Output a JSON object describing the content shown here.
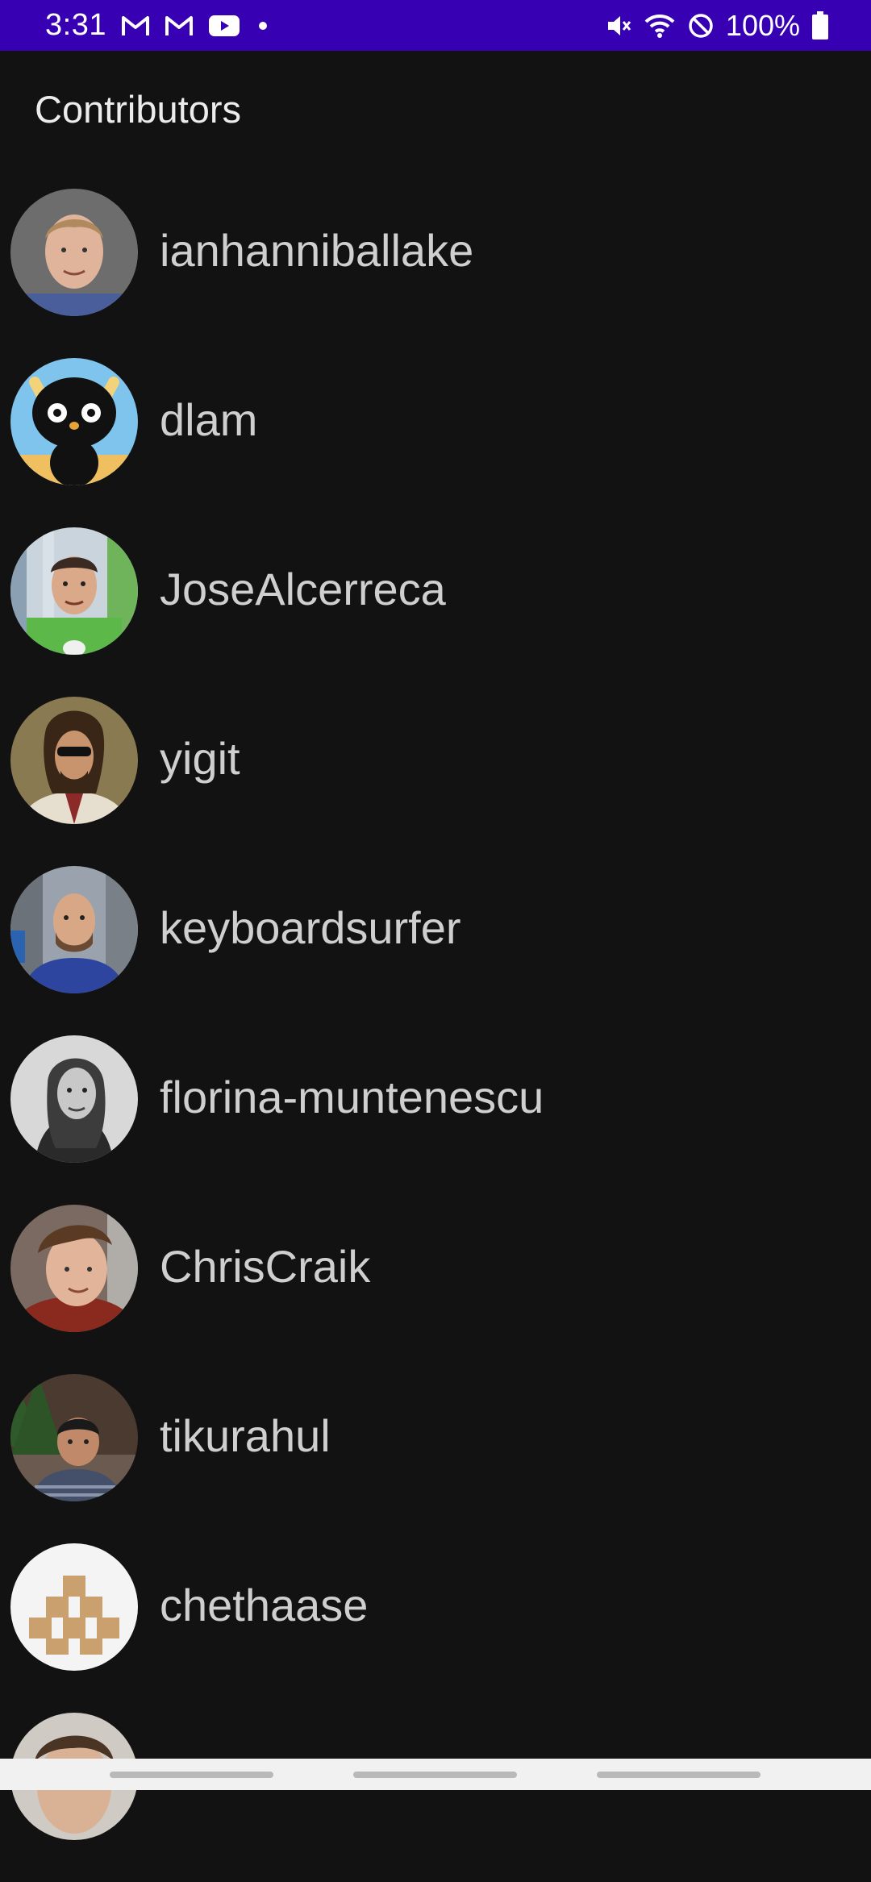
{
  "status_bar": {
    "time": "3:31",
    "battery": "100%",
    "color": "#3700b3",
    "notification_icons": [
      "gmail-icon",
      "gmail-icon",
      "youtube-icon",
      "dot-icon"
    ],
    "system_icons": [
      "mute-icon",
      "wifi-icon",
      "do-not-disturb-icon",
      "battery-icon"
    ]
  },
  "page": {
    "title": "Contributors",
    "background": "#121212"
  },
  "contributors": [
    {
      "name": "ianhanniballake"
    },
    {
      "name": "dlam"
    },
    {
      "name": "JoseAlcerreca"
    },
    {
      "name": "yigit"
    },
    {
      "name": "keyboardsurfer"
    },
    {
      "name": "florina-muntenescu"
    },
    {
      "name": "ChrisCraik"
    },
    {
      "name": "tikurahul"
    },
    {
      "name": "chethaase"
    }
  ]
}
